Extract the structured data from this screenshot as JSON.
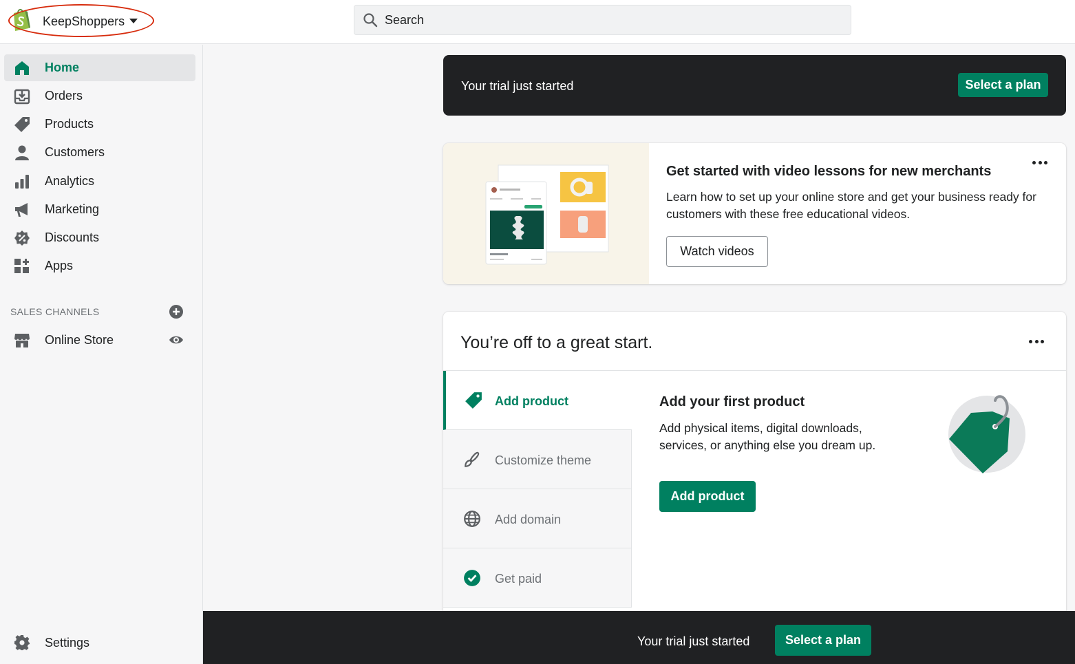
{
  "header": {
    "store_name": "KeepShoppers",
    "search_placeholder": "Search"
  },
  "sidebar": {
    "items": [
      {
        "label": "Home",
        "icon": "home-icon",
        "active": true
      },
      {
        "label": "Orders",
        "icon": "orders-icon"
      },
      {
        "label": "Products",
        "icon": "tag-icon"
      },
      {
        "label": "Customers",
        "icon": "person-icon"
      },
      {
        "label": "Analytics",
        "icon": "bar-chart-icon"
      },
      {
        "label": "Marketing",
        "icon": "megaphone-icon"
      },
      {
        "label": "Discounts",
        "icon": "discount-icon"
      },
      {
        "label": "Apps",
        "icon": "apps-icon"
      }
    ],
    "sales_channels_title": "SALES CHANNELS",
    "channels": [
      {
        "label": "Online Store",
        "icon": "store-icon"
      }
    ],
    "settings_label": "Settings"
  },
  "trial_banner": {
    "text": "Your trial just started",
    "button": "Select a plan"
  },
  "video_card": {
    "title": "Get started with video lessons for new merchants",
    "description": "Learn how to set up your online store and get your business ready for customers with these free educational videos.",
    "button": "Watch videos"
  },
  "start_card": {
    "title": "You’re off to a great start.",
    "steps": [
      {
        "label": "Add product",
        "icon": "tag-icon",
        "active": true
      },
      {
        "label": "Customize theme",
        "icon": "brush-icon"
      },
      {
        "label": "Add domain",
        "icon": "globe-icon"
      },
      {
        "label": "Get paid",
        "icon": "check-circle-icon"
      }
    ],
    "detail": {
      "title": "Add your first product",
      "description": "Add physical items, digital downloads, services, or anything else you dream up.",
      "button": "Add product"
    }
  },
  "bottom_banner": {
    "text": "Your trial just started",
    "button": "Select a plan"
  },
  "colors": {
    "brand_green": "#008060",
    "dark_banner": "#202123",
    "highlight_ellipse": "#d72c0d"
  }
}
